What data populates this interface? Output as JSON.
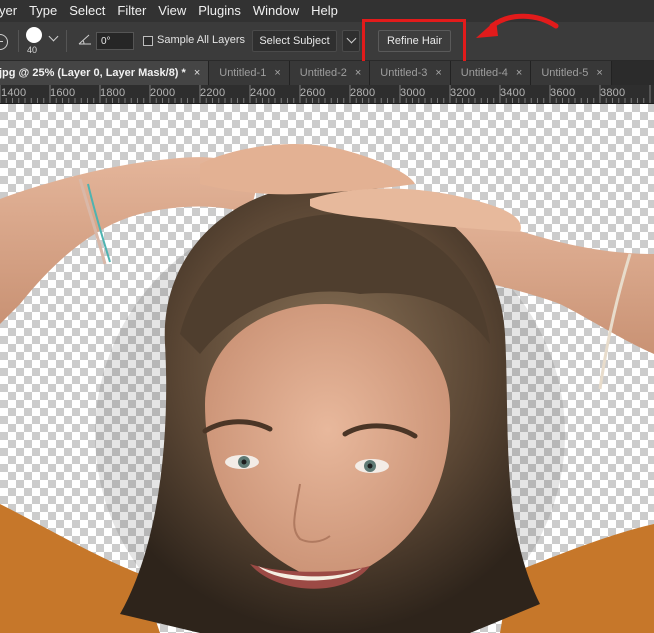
{
  "menu": [
    "yer",
    "Type",
    "Select",
    "Filter",
    "View",
    "Plugins",
    "Window",
    "Help"
  ],
  "options": {
    "brush_size": "40",
    "angle_value": "0°",
    "sample_all_layers_label": "Sample All Layers",
    "sample_all_layers_checked": false,
    "select_subject_label": "Select Subject",
    "refine_hair_label": "Refine Hair"
  },
  "tabs": [
    {
      "label": "jpg @ 25% (Layer 0, Layer Mask/8) *",
      "active": true
    },
    {
      "label": "Untitled-1",
      "active": false
    },
    {
      "label": "Untitled-2",
      "active": false
    },
    {
      "label": "Untitled-3",
      "active": false
    },
    {
      "label": "Untitled-4",
      "active": false
    },
    {
      "label": "Untitled-5",
      "active": false
    }
  ],
  "tab_close_glyph": "×",
  "ruler": [
    "1400",
    "1600",
    "1800",
    "2000",
    "2200",
    "2400",
    "2600",
    "2800",
    "3000",
    "3200",
    "3400",
    "3600",
    "3800"
  ],
  "colors": {
    "highlight": "#e21b1b",
    "menubar_bg": "#323232",
    "optionsbar_bg": "#3b3b3b"
  },
  "icons": {
    "tool": "circle-brush-tool-icon",
    "brush_preview": "brush-preview-icon",
    "angle": "angle-icon",
    "annotation": "curved-arrow-icon"
  }
}
